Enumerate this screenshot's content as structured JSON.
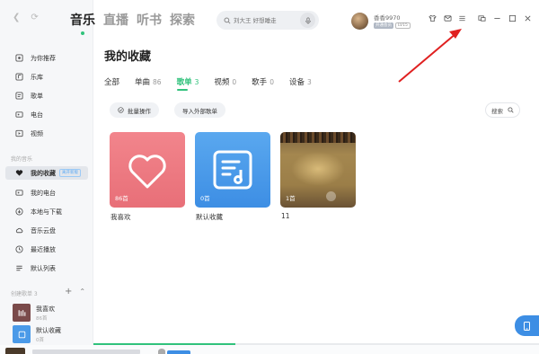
{
  "nav": {
    "back_icon": "chevron-left-icon",
    "forward_icon": "refresh-icon"
  },
  "main_tabs": [
    {
      "label": "音乐",
      "active": true
    },
    {
      "label": "直播",
      "active": false
    },
    {
      "label": "听书",
      "active": false
    },
    {
      "label": "探索",
      "active": false
    }
  ],
  "search": {
    "placeholder": "刘大王 好想睡走"
  },
  "user": {
    "name": "香香9970",
    "vip_badge": "开通会员",
    "level_badge": "LV15"
  },
  "sidebar": {
    "items": [
      {
        "label": "为你推荐",
        "icon": "recommend-icon"
      },
      {
        "label": "乐库",
        "icon": "library-icon"
      },
      {
        "label": "歌单",
        "icon": "playlist-icon"
      },
      {
        "label": "电台",
        "icon": "radio-icon"
      },
      {
        "label": "视频",
        "icon": "video-icon"
      }
    ],
    "section_mine": "我的音乐",
    "mine_items": [
      {
        "label": "我的收藏",
        "icon": "heart-icon",
        "badge": "离开新版",
        "active": true
      },
      {
        "label": "我的电台",
        "icon": "radio-icon"
      },
      {
        "label": "本地与下载",
        "icon": "download-icon"
      },
      {
        "label": "音乐云盘",
        "icon": "cloud-icon"
      },
      {
        "label": "最近播放",
        "icon": "history-icon"
      },
      {
        "label": "默认列表",
        "icon": "list-icon"
      }
    ],
    "section_created": "创建歌单 3",
    "created_playlists": [
      {
        "name": "我喜欢",
        "count": "86首"
      },
      {
        "name": "默认收藏",
        "count": "0首"
      }
    ]
  },
  "page": {
    "title": "我的收藏",
    "tabs": [
      {
        "label": "全部",
        "count": ""
      },
      {
        "label": "单曲",
        "count": "86"
      },
      {
        "label": "歌单",
        "count": "3",
        "active": true
      },
      {
        "label": "视频",
        "count": "0"
      },
      {
        "label": "歌手",
        "count": "0"
      },
      {
        "label": "设备",
        "count": "3"
      }
    ],
    "batch_label": "批量操作",
    "import_label": "导入外部歌单",
    "search_label": "搜索"
  },
  "cards": [
    {
      "name": "我喜欢",
      "count": "86首",
      "color": "#ee7b83",
      "icon": "heart-icon"
    },
    {
      "name": "默认收藏",
      "count": "0首",
      "color": "#4b9ae8",
      "icon": "music-list-icon"
    },
    {
      "name": "11",
      "count": "1首",
      "color": "#8f7446",
      "icon": "concert-photo"
    }
  ],
  "colors": {
    "accent": "#31c27c",
    "annotation": "#e02020"
  }
}
